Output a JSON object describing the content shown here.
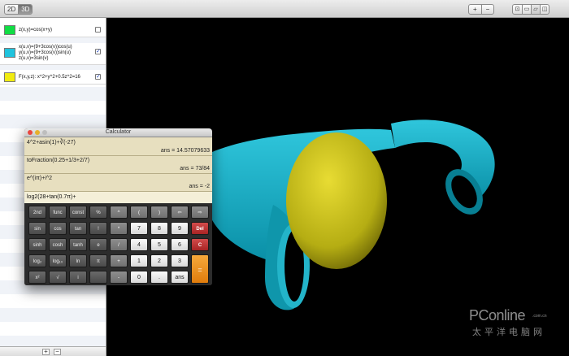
{
  "toolbar": {
    "mode": [
      "2D",
      "3D"
    ],
    "zoom": [
      "+",
      "−"
    ],
    "views": [
      "⊡",
      "▭",
      "▱",
      "◫"
    ]
  },
  "equations": [
    {
      "color": "#11dd44",
      "lines": [
        "z(x,y)=cos(x+y)"
      ],
      "checked": false
    },
    {
      "color": "#20c3dd",
      "lines": [
        "x(u,v)=(9+3cos(v))cos(u)",
        "y(u,v)=(9+3cos(v))sin(u)",
        "z(u,v)=3sin(v)"
      ],
      "checked": true
    },
    {
      "color": "#f1ec12",
      "lines": [
        "F(x,y,z): x^2+y^2+0.5z^2=16"
      ],
      "checked": true
    }
  ],
  "sidebar_footer": {
    "add": "+",
    "remove": "−"
  },
  "calculator": {
    "title": "Calculator",
    "history": [
      {
        "expr": "4^2+asin(1)+∛(-27)",
        "ans": "ans = 14.57079633"
      },
      {
        "expr": "toFraction(0.25+1/3+2/7)",
        "ans": "ans = 73/84"
      },
      {
        "expr": "e^(iπ)+i^2",
        "ans": "ans = -2"
      }
    ],
    "input": "log2(28+tan(0.7π)+",
    "keys": [
      [
        "2nd",
        "func",
        "const",
        "%",
        "^",
        "(",
        ")",
        "⇦",
        "⇨"
      ],
      [
        "sin",
        "cos",
        "tan",
        "!",
        "*",
        "7",
        "8",
        "9",
        "Del"
      ],
      [
        "sinh",
        "cosh",
        "tanh",
        "e",
        "/",
        "4",
        "5",
        "6",
        "C"
      ],
      [
        "log₂",
        "log₁₀",
        "ln",
        "π",
        "+",
        "1",
        "2",
        "3",
        "="
      ],
      [
        "x²",
        "√",
        "i",
        "",
        "-",
        "0",
        ".",
        "ans"
      ]
    ]
  },
  "watermark": {
    "logo": "PConline",
    "sub": ".com.cn",
    "cn": "太平洋电脑网"
  }
}
